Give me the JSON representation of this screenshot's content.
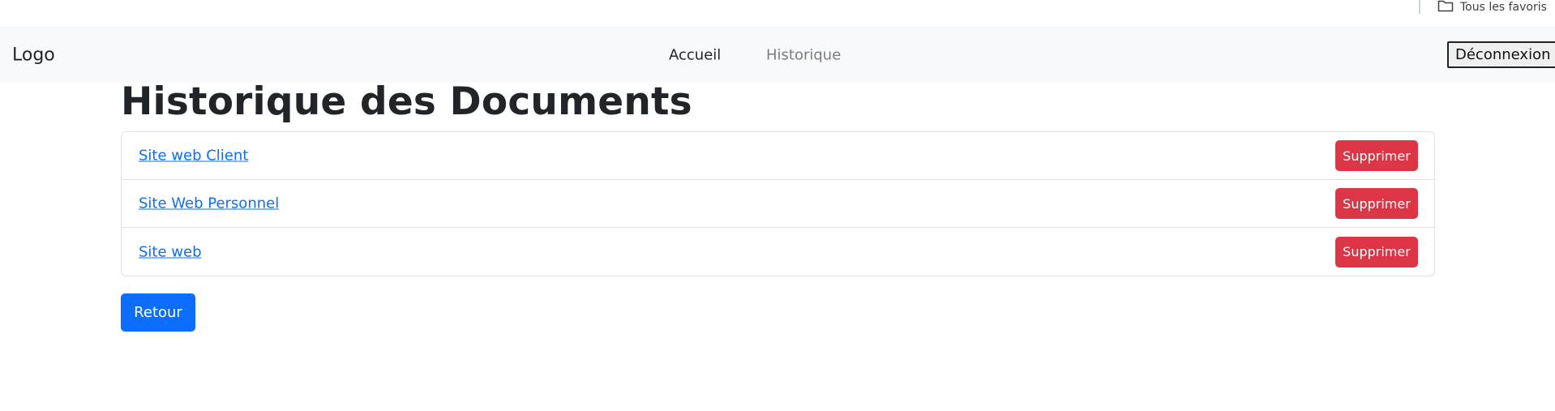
{
  "bookmarks_bar": {
    "folder_icon": "folder-icon",
    "label": "Tous les favoris"
  },
  "navbar": {
    "brand": "Logo",
    "links": [
      {
        "label": "Accueil"
      },
      {
        "label": "Historique"
      }
    ],
    "logout_label": "Déconnexion"
  },
  "main": {
    "title": "Historique des Documents",
    "documents": [
      {
        "name": "Site web Client",
        "action_label": "Supprimer"
      },
      {
        "name": "Site Web Personnel",
        "action_label": "Supprimer"
      },
      {
        "name": "Site web",
        "action_label": "Supprimer"
      }
    ],
    "back_label": "Retour"
  },
  "colors": {
    "primary": "#0d6efd",
    "danger": "#dc3545",
    "navbar_bg": "#f8f9fa",
    "muted_link": "#7d7d7d"
  }
}
